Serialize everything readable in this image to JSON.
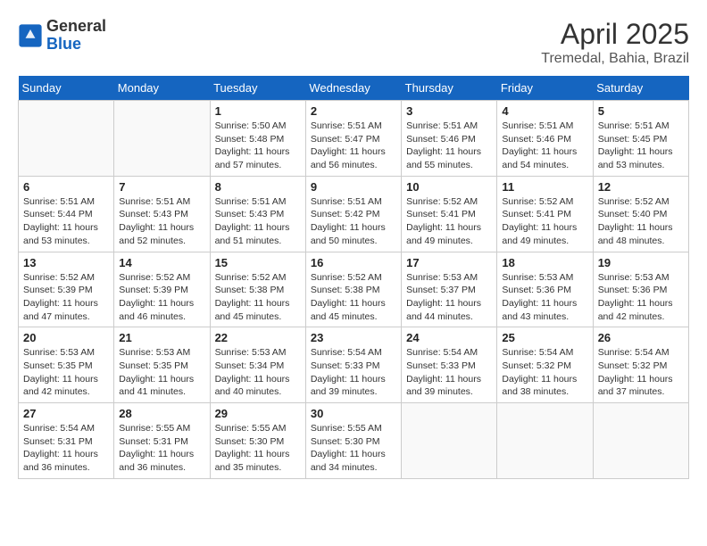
{
  "header": {
    "logo_line1": "General",
    "logo_line2": "Blue",
    "main_title": "April 2025",
    "subtitle": "Tremedal, Bahia, Brazil"
  },
  "weekdays": [
    "Sunday",
    "Monday",
    "Tuesday",
    "Wednesday",
    "Thursday",
    "Friday",
    "Saturday"
  ],
  "weeks": [
    [
      {
        "day": "",
        "info": ""
      },
      {
        "day": "",
        "info": ""
      },
      {
        "day": "1",
        "info": "Sunrise: 5:50 AM\nSunset: 5:48 PM\nDaylight: 11 hours and 57 minutes."
      },
      {
        "day": "2",
        "info": "Sunrise: 5:51 AM\nSunset: 5:47 PM\nDaylight: 11 hours and 56 minutes."
      },
      {
        "day": "3",
        "info": "Sunrise: 5:51 AM\nSunset: 5:46 PM\nDaylight: 11 hours and 55 minutes."
      },
      {
        "day": "4",
        "info": "Sunrise: 5:51 AM\nSunset: 5:46 PM\nDaylight: 11 hours and 54 minutes."
      },
      {
        "day": "5",
        "info": "Sunrise: 5:51 AM\nSunset: 5:45 PM\nDaylight: 11 hours and 53 minutes."
      }
    ],
    [
      {
        "day": "6",
        "info": "Sunrise: 5:51 AM\nSunset: 5:44 PM\nDaylight: 11 hours and 53 minutes."
      },
      {
        "day": "7",
        "info": "Sunrise: 5:51 AM\nSunset: 5:43 PM\nDaylight: 11 hours and 52 minutes."
      },
      {
        "day": "8",
        "info": "Sunrise: 5:51 AM\nSunset: 5:43 PM\nDaylight: 11 hours and 51 minutes."
      },
      {
        "day": "9",
        "info": "Sunrise: 5:51 AM\nSunset: 5:42 PM\nDaylight: 11 hours and 50 minutes."
      },
      {
        "day": "10",
        "info": "Sunrise: 5:52 AM\nSunset: 5:41 PM\nDaylight: 11 hours and 49 minutes."
      },
      {
        "day": "11",
        "info": "Sunrise: 5:52 AM\nSunset: 5:41 PM\nDaylight: 11 hours and 49 minutes."
      },
      {
        "day": "12",
        "info": "Sunrise: 5:52 AM\nSunset: 5:40 PM\nDaylight: 11 hours and 48 minutes."
      }
    ],
    [
      {
        "day": "13",
        "info": "Sunrise: 5:52 AM\nSunset: 5:39 PM\nDaylight: 11 hours and 47 minutes."
      },
      {
        "day": "14",
        "info": "Sunrise: 5:52 AM\nSunset: 5:39 PM\nDaylight: 11 hours and 46 minutes."
      },
      {
        "day": "15",
        "info": "Sunrise: 5:52 AM\nSunset: 5:38 PM\nDaylight: 11 hours and 45 minutes."
      },
      {
        "day": "16",
        "info": "Sunrise: 5:52 AM\nSunset: 5:38 PM\nDaylight: 11 hours and 45 minutes."
      },
      {
        "day": "17",
        "info": "Sunrise: 5:53 AM\nSunset: 5:37 PM\nDaylight: 11 hours and 44 minutes."
      },
      {
        "day": "18",
        "info": "Sunrise: 5:53 AM\nSunset: 5:36 PM\nDaylight: 11 hours and 43 minutes."
      },
      {
        "day": "19",
        "info": "Sunrise: 5:53 AM\nSunset: 5:36 PM\nDaylight: 11 hours and 42 minutes."
      }
    ],
    [
      {
        "day": "20",
        "info": "Sunrise: 5:53 AM\nSunset: 5:35 PM\nDaylight: 11 hours and 42 minutes."
      },
      {
        "day": "21",
        "info": "Sunrise: 5:53 AM\nSunset: 5:35 PM\nDaylight: 11 hours and 41 minutes."
      },
      {
        "day": "22",
        "info": "Sunrise: 5:53 AM\nSunset: 5:34 PM\nDaylight: 11 hours and 40 minutes."
      },
      {
        "day": "23",
        "info": "Sunrise: 5:54 AM\nSunset: 5:33 PM\nDaylight: 11 hours and 39 minutes."
      },
      {
        "day": "24",
        "info": "Sunrise: 5:54 AM\nSunset: 5:33 PM\nDaylight: 11 hours and 39 minutes."
      },
      {
        "day": "25",
        "info": "Sunrise: 5:54 AM\nSunset: 5:32 PM\nDaylight: 11 hours and 38 minutes."
      },
      {
        "day": "26",
        "info": "Sunrise: 5:54 AM\nSunset: 5:32 PM\nDaylight: 11 hours and 37 minutes."
      }
    ],
    [
      {
        "day": "27",
        "info": "Sunrise: 5:54 AM\nSunset: 5:31 PM\nDaylight: 11 hours and 36 minutes."
      },
      {
        "day": "28",
        "info": "Sunrise: 5:55 AM\nSunset: 5:31 PM\nDaylight: 11 hours and 36 minutes."
      },
      {
        "day": "29",
        "info": "Sunrise: 5:55 AM\nSunset: 5:30 PM\nDaylight: 11 hours and 35 minutes."
      },
      {
        "day": "30",
        "info": "Sunrise: 5:55 AM\nSunset: 5:30 PM\nDaylight: 11 hours and 34 minutes."
      },
      {
        "day": "",
        "info": ""
      },
      {
        "day": "",
        "info": ""
      },
      {
        "day": "",
        "info": ""
      }
    ]
  ]
}
